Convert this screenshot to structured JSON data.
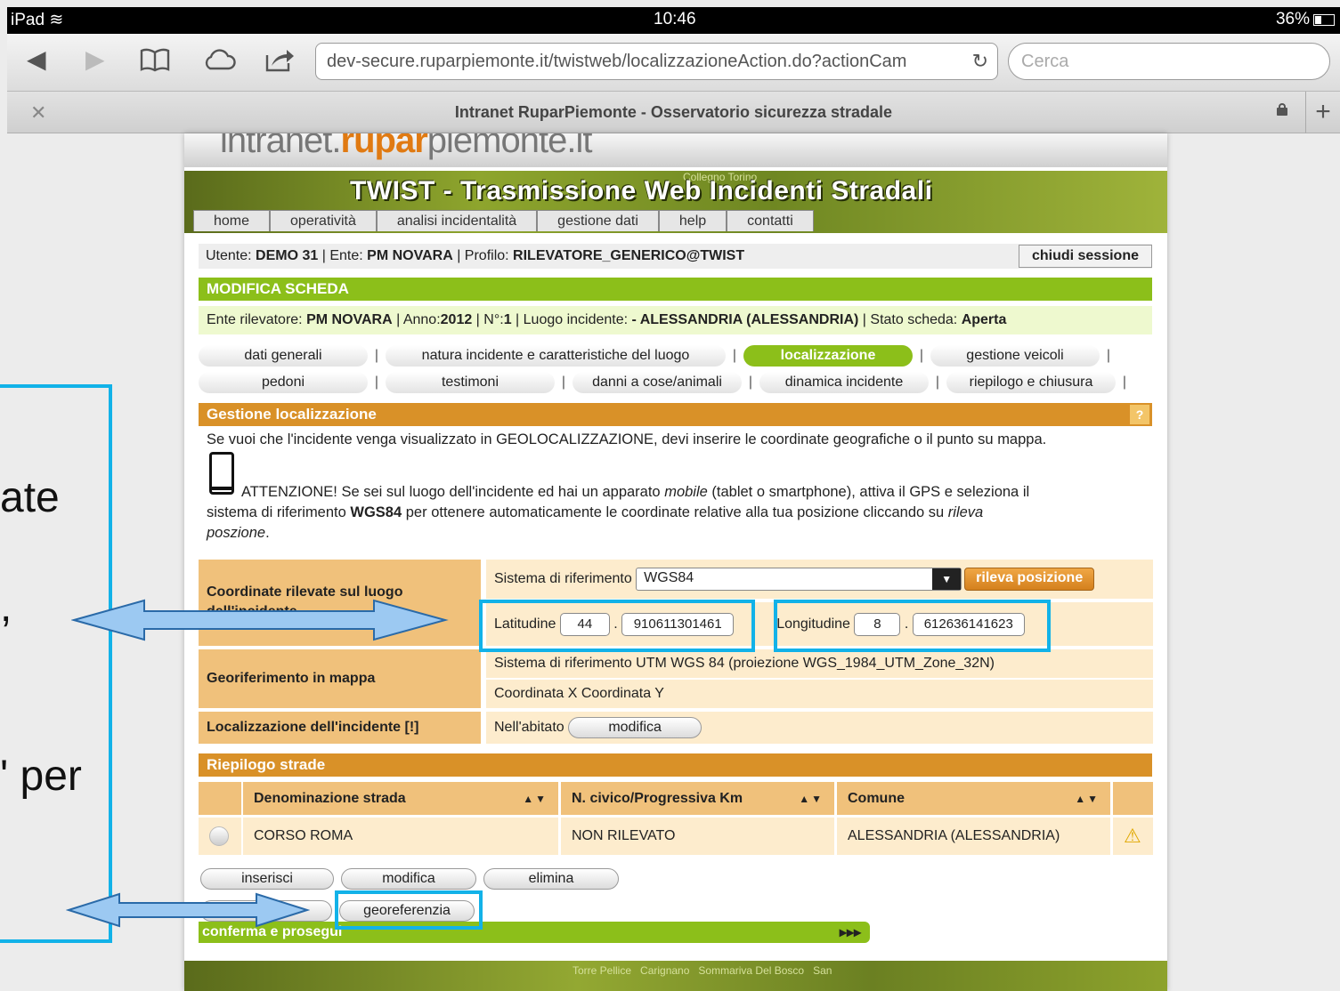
{
  "status": {
    "device": "iPad",
    "time": "10:46",
    "battery": "36%"
  },
  "browser": {
    "url": "dev-secure.ruparpiemonte.it/twistweb/localizzazioneAction.do?actionCam",
    "search_placeholder": "Cerca",
    "tab_title": "Intranet RuparPiemonte - Osservatorio sicurezza stradale"
  },
  "site": {
    "logo_pre": "intranet.",
    "logo_brand": "rupar",
    "logo_post": "piemonte.it",
    "banner_title": "TWIST - Trasmissione Web Incidenti Stradali",
    "banner_places_top": "Collegno Torino",
    "banner_places_bottom": "Torre Pellice   Carignano   Sommariva Del Bosco   San",
    "nav": [
      "home",
      "operatività",
      "analisi incidentalità",
      "gestione dati",
      "help",
      "contatti"
    ]
  },
  "user": {
    "utente_label": "Utente:",
    "utente": "DEMO 31",
    "ente_label": "Ente:",
    "ente": "PM NOVARA",
    "profilo_label": "Profilo:",
    "profilo": "RILEVATORE_GENERICO@TWIST",
    "logout": "chiudi sessione"
  },
  "scheda": {
    "header": "MODIFICA SCHEDA",
    "ente_label": "Ente rilevatore:",
    "ente": "PM NOVARA",
    "anno_label": "Anno:",
    "anno": "2012",
    "num_label": "N°:",
    "num": "1",
    "luogo_label": "Luogo incidente:",
    "luogo": "- ALESSANDRIA (ALESSANDRIA)",
    "stato_label": "Stato scheda:",
    "stato": "Aperta"
  },
  "tabs": {
    "dati": "dati generali",
    "natura": "natura incidente e caratteristiche del luogo",
    "localizzazione": "localizzazione",
    "veicoli": "gestione veicoli",
    "pedoni": "pedoni",
    "testimoni": "testimoni",
    "danni": "danni a cose/animali",
    "dinamica": "dinamica incidente",
    "riepilogo": "riepilogo e chiusura",
    "separator": "|"
  },
  "loc": {
    "header": "Gestione localizzazione",
    "help": "?",
    "intro": "Se vuoi che l'incidente venga visualizzato in GEOLOCALIZZAZIONE, devi inserire le coordinate geografiche o il punto su mappa.",
    "warn_1": "ATTENZIONE! Se sei sul luogo dell'incidente ed hai un apparato ",
    "warn_mobile": "mobile",
    "warn_2": " (tablet o smartphone), attiva il GPS e seleziona il",
    "warn_3": "sistema di riferimento ",
    "warn_wgs": "WGS84",
    "warn_4": " per ottenere automaticamente le coordinate relative alla tua posizione cliccando su ",
    "warn_rileva": "rileva",
    "warn_5": "poszione",
    "warn_6": ".",
    "coord_label": "Coordinate rilevate sul luogo dell'incidente",
    "sistema_label": "Sistema di riferimento",
    "sistema_value": "WGS84",
    "rileva_btn": "rileva posizione",
    "lat_label": "Latitudine",
    "lat_int": "44",
    "lat_dec": "910611301461",
    "lon_label": "Longitudine",
    "lon_int": "8",
    "lon_dec": "612636141623",
    "dot": ".",
    "geo_label": "Georiferimento in mappa",
    "utm_text": "Sistema di riferimento UTM WGS 84 (proiezione WGS_1984_UTM_Zone_32N)",
    "xy_text": "Coordinata X Coordinata Y",
    "loc_label": "Localizzazione dell'incidente [!]",
    "abitato": "Nell'abitato",
    "modifica": "modifica"
  },
  "strade": {
    "header": "Riepilogo strade",
    "columns": [
      "Denominazione strada",
      "N. civico/Progressiva Km",
      "Comune"
    ],
    "sort_glyph": "▲▼",
    "row": {
      "strada": "CORSO ROMA",
      "civico": "NON RILEVATO",
      "comune": "ALESSANDRIA (ALESSANDRIA)",
      "warn": "⚠"
    },
    "btn_inserisci": "inserisci",
    "btn_modifica": "modifica",
    "btn_elimina": "elimina",
    "btn_georeferenzia": "georeferenzia",
    "conferma": "conferma e prosegui",
    "conferma_arrows": "▸▸▸"
  },
  "overlay": {
    "line1": "ate",
    "line2": ",",
    "line3": "' per"
  },
  "colors": {
    "green": "#8cbf1a",
    "orange": "#d99128",
    "highlight": "#12b2e8"
  }
}
